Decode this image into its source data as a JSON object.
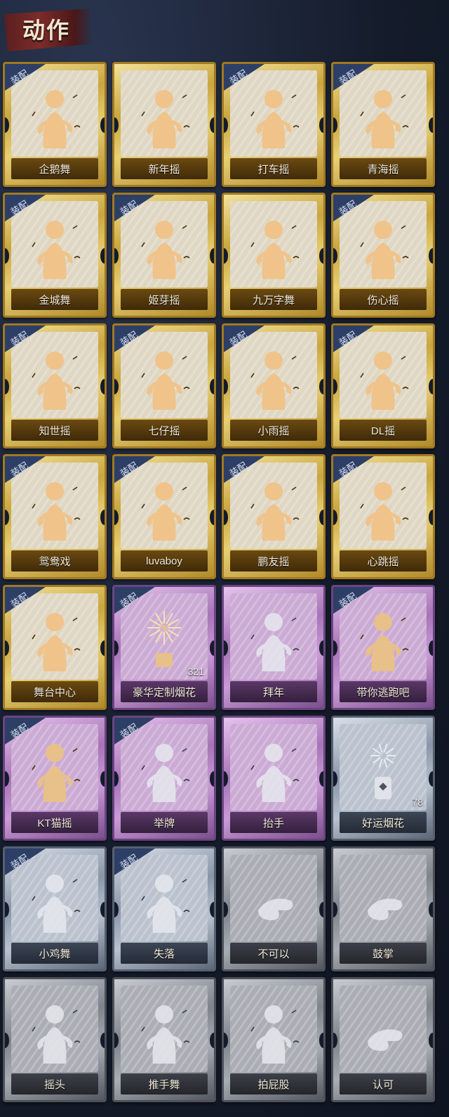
{
  "header": {
    "title": "动作"
  },
  "badge_text": "装配",
  "cards": [
    {
      "label": "企鹅舞",
      "rarity": "gold",
      "equipped": true,
      "icon": "dance-figure-icon"
    },
    {
      "label": "新年摇",
      "rarity": "gold",
      "equipped": false,
      "icon": "dance-figure-icon"
    },
    {
      "label": "打车摇",
      "rarity": "gold",
      "equipped": true,
      "icon": "dance-figure-icon"
    },
    {
      "label": "青海摇",
      "rarity": "gold",
      "equipped": true,
      "icon": "dance-figure-icon"
    },
    {
      "label": "金城舞",
      "rarity": "gold",
      "equipped": true,
      "icon": "dance-figure-icon"
    },
    {
      "label": "姬芽摇",
      "rarity": "gold",
      "equipped": true,
      "icon": "dance-figure-icon"
    },
    {
      "label": "九万字舞",
      "rarity": "gold",
      "equipped": false,
      "icon": "dance-figure-icon"
    },
    {
      "label": "伤心摇",
      "rarity": "gold",
      "equipped": true,
      "icon": "heart-hands-icon"
    },
    {
      "label": "知世摇",
      "rarity": "gold",
      "equipped": true,
      "icon": "dance-figure-icon"
    },
    {
      "label": "七仔摇",
      "rarity": "gold",
      "equipped": true,
      "icon": "dance-figure-icon"
    },
    {
      "label": "小雨摇",
      "rarity": "gold",
      "equipped": true,
      "icon": "dance-figure-icon"
    },
    {
      "label": "DL摇",
      "rarity": "gold",
      "equipped": true,
      "icon": "dance-figure-icon"
    },
    {
      "label": "鸳鸯戏",
      "rarity": "gold",
      "equipped": true,
      "icon": "dance-figure-icon"
    },
    {
      "label": "luvaboy",
      "rarity": "gold",
      "equipped": true,
      "icon": "dance-figure-icon"
    },
    {
      "label": "鹏友摇",
      "rarity": "gold",
      "equipped": true,
      "icon": "dance-figure-icon"
    },
    {
      "label": "心跳摇",
      "rarity": "gold",
      "equipped": true,
      "icon": "dance-figure-icon"
    },
    {
      "label": "舞台中心",
      "rarity": "gold",
      "equipped": true,
      "icon": "dance-figure-icon"
    },
    {
      "label": "豪华定制烟花",
      "rarity": "purple",
      "equipped": true,
      "icon": "fireworks-icon",
      "count": "321"
    },
    {
      "label": "拜年",
      "rarity": "purple-dim",
      "equipped": false,
      "icon": "bow-figure-icon"
    },
    {
      "label": "带你逃跑吧",
      "rarity": "purple",
      "equipped": true,
      "icon": "dance-figure-icon"
    },
    {
      "label": "KT猫摇",
      "rarity": "purple",
      "equipped": true,
      "icon": "dance-figure-icon"
    },
    {
      "label": "举牌",
      "rarity": "purple-dim",
      "equipped": true,
      "icon": "sign-holding-icon"
    },
    {
      "label": "抬手",
      "rarity": "purple-dim",
      "equipped": false,
      "icon": "raise-hand-icon"
    },
    {
      "label": "好运烟花",
      "rarity": "silver",
      "equipped": false,
      "icon": "firework-can-icon",
      "count": "78"
    },
    {
      "label": "小鸡舞",
      "rarity": "silver",
      "equipped": true,
      "icon": "chicken-dance-icon"
    },
    {
      "label": "失落",
      "rarity": "silver",
      "equipped": true,
      "icon": "crawl-figure-icon"
    },
    {
      "label": "不可以",
      "rarity": "grey",
      "equipped": false,
      "icon": "finger-wag-icon"
    },
    {
      "label": "鼓掌",
      "rarity": "grey",
      "equipped": false,
      "icon": "clap-hands-icon"
    },
    {
      "label": "摇头",
      "rarity": "grey",
      "equipped": false,
      "icon": "shake-head-icon"
    },
    {
      "label": "推手舞",
      "rarity": "grey",
      "equipped": false,
      "icon": "push-hands-icon"
    },
    {
      "label": "拍屁股",
      "rarity": "grey",
      "equipped": false,
      "icon": "bend-figure-icon"
    },
    {
      "label": "认可",
      "rarity": "grey",
      "equipped": false,
      "icon": "thumbs-up-icon"
    }
  ]
}
